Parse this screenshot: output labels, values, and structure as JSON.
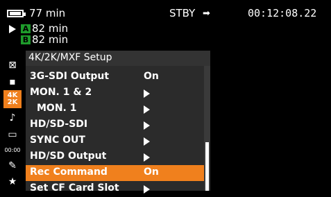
{
  "status": {
    "battery_time": "77 min",
    "slot_a": "A",
    "slot_a_time": "82 min",
    "slot_b": "B",
    "slot_b_time": "82 min",
    "mode": "STBY",
    "timecode": "00:12:08.22"
  },
  "left_icons": [
    {
      "name": "close-icon",
      "glyph": "⊠"
    },
    {
      "name": "camera-icon",
      "glyph": "▪"
    },
    {
      "name": "4k2k-icon",
      "glyph": "4K 2K"
    },
    {
      "name": "audio-icon",
      "glyph": "♪"
    },
    {
      "name": "display-icon",
      "glyph": "▭"
    },
    {
      "name": "timecode-icon",
      "glyph": "00:00"
    },
    {
      "name": "wrench-icon",
      "glyph": "✎"
    },
    {
      "name": "star-icon",
      "glyph": "★"
    }
  ],
  "menu": {
    "title": "4K/2K/MXF Setup",
    "items": [
      {
        "label": "3G-SDI Output",
        "value": "On",
        "arrow": false,
        "indent": false,
        "selected": false
      },
      {
        "label": "MON. 1 & 2",
        "value": "",
        "arrow": true,
        "indent": false,
        "selected": false
      },
      {
        "label": "MON. 1",
        "value": "",
        "arrow": true,
        "indent": true,
        "selected": false
      },
      {
        "label": "HD/SD-SDI",
        "value": "",
        "arrow": true,
        "indent": false,
        "selected": false
      },
      {
        "label": "SYNC OUT",
        "value": "",
        "arrow": true,
        "indent": false,
        "selected": false
      },
      {
        "label": "HD/SD Output",
        "value": "",
        "arrow": true,
        "indent": false,
        "selected": false
      },
      {
        "label": "Rec Command",
        "value": "On",
        "arrow": false,
        "indent": false,
        "selected": true
      },
      {
        "label": "Set CF Card Slot",
        "value": "",
        "arrow": true,
        "indent": false,
        "selected": false
      }
    ]
  },
  "colors": {
    "selection": "#f0801d",
    "slot_green": "#1e9b2b",
    "menu_bg": "#2b2b2b",
    "header_bg": "#333333"
  }
}
